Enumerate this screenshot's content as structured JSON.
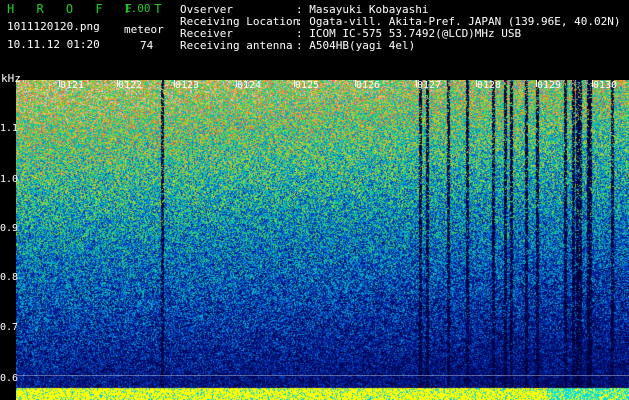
{
  "header": {
    "app_title": "H R O F F T",
    "app_version": "1.00",
    "filename": "1011120120.png",
    "datetime": "10.11.12 01:20",
    "meteor_label": "meteor",
    "meteor_count": "74",
    "info": [
      {
        "key": "Ovserver",
        "value": ": Masayuki Kobayashi"
      },
      {
        "key": "Receiving Location",
        "value": ": Ogata-vill. Akita-Pref. JAPAN (139.96E, 40.02N)"
      },
      {
        "key": "Receiver",
        "value": ": ICOM IC-575 53.7492(@LCD)MHz USB"
      },
      {
        "key": "Receiving antenna",
        "value": ": A504HB(yagi 4el)"
      }
    ]
  },
  "plot": {
    "y_unit": "kHz",
    "y_ticks": [
      "1.1",
      "1.0",
      "0.9",
      "0.8",
      "0.7",
      "0.6"
    ],
    "x_ticks": [
      "0121",
      "0122",
      "0123",
      "0124",
      "0125",
      "0126",
      "0127",
      "0128",
      "0129",
      "0130"
    ]
  }
}
